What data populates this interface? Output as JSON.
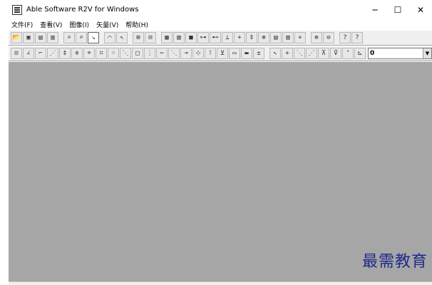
{
  "window": {
    "title": "Able Software R2V for Windows",
    "controls": {
      "minimize": "─",
      "maximize": "☐",
      "close": "✕"
    }
  },
  "menu": [
    "文件(F)",
    "查看(V)",
    "图像(I)",
    "矢量(V)",
    "帮助(H)"
  ],
  "toolbar1": [
    "📂",
    "▣",
    "▤",
    "▥",
    "⌕",
    "⌕",
    "↘",
    "⌒",
    "↖",
    "⊞",
    "⊟",
    "▦",
    "▧",
    "■",
    "⊶",
    "⊷",
    "⊥",
    "+",
    "‡",
    "⊗",
    "▤",
    "▥",
    "+",
    "⊕",
    "⊖",
    "?",
    "?"
  ],
  "toolbar2": [
    "⊡",
    "∠",
    "⌐",
    "⋰",
    "‡",
    "≑",
    "⌖",
    "⌗",
    "⁘",
    "⋱",
    "□",
    "⋮",
    "⋯",
    "⋱",
    "⊸",
    "⊹",
    "⊺",
    "⊻",
    "▭",
    "▬",
    "±",
    "↖",
    "+",
    "⋱",
    "⋰",
    "⊼",
    "⊽",
    "ʼ",
    "⊾"
  ],
  "line_width_value": "0",
  "watermark": "最需教育"
}
